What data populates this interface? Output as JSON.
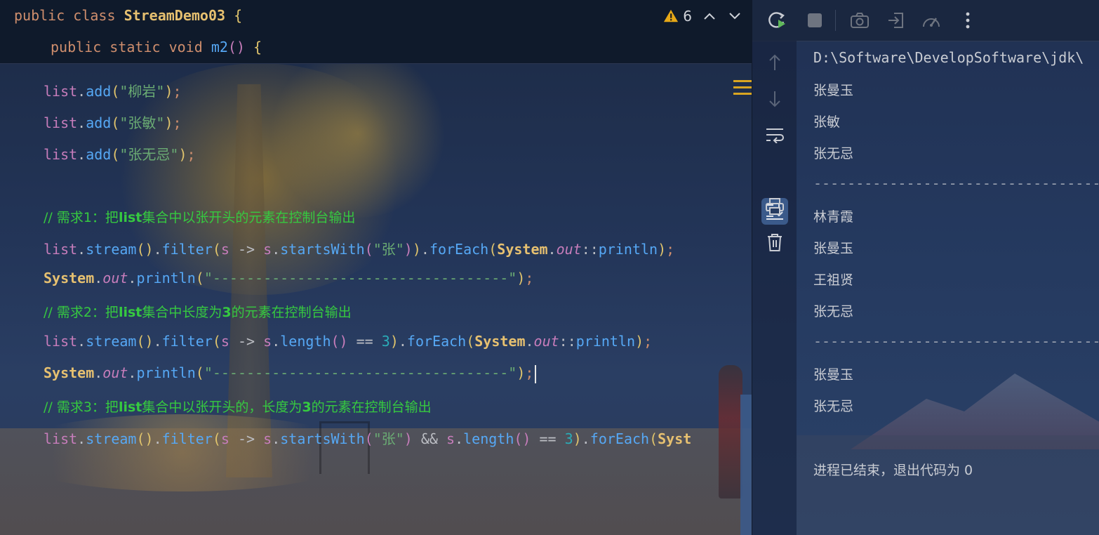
{
  "editor": {
    "sticky": {
      "line1": {
        "kw_public": "public",
        "kw_class": "class",
        "class_name": "StreamDemo03",
        "brace": "{"
      },
      "line2": {
        "kw_public": "public",
        "kw_static": "static",
        "kw_void": "void",
        "method": "m2",
        "parens": "()",
        "brace": "{"
      }
    },
    "warnings": {
      "count": "6"
    },
    "code": {
      "l1": {
        "var": "list",
        "method": "add",
        "arg": "\"柳岩\""
      },
      "l2": {
        "var": "list",
        "method": "add",
        "arg": "\"张敏\""
      },
      "l3": {
        "var": "list",
        "method": "add",
        "arg": "\"张无忌\""
      },
      "c1": {
        "prefix": "// 需求1：把",
        "bold": "list",
        "rest": "集合中以张开头的元素在控制台输出"
      },
      "s1": {
        "var": "list",
        "stream": "stream",
        "filter": "filter",
        "param": "s",
        "arrow": "->",
        "param2": "s",
        "startsWith": "startsWith",
        "arg": "\"张\"",
        "forEach": "forEach",
        "system": "System",
        "out": "out",
        "println": "println"
      },
      "p1": {
        "system": "System",
        "out": "out",
        "println": "println",
        "arg": "\"-----------------------------------\""
      },
      "c2": {
        "prefix": "// 需求2：把",
        "bold1": "list",
        "mid": "集合中长度为",
        "bold2": "3",
        "rest": "的元素在控制台输出"
      },
      "s2": {
        "var": "list",
        "stream": "stream",
        "filter": "filter",
        "param": "s",
        "arrow": "->",
        "param2": "s",
        "length": "length",
        "eq": "==",
        "num": "3",
        "forEach": "forEach",
        "system": "System",
        "out": "out",
        "println": "println"
      },
      "p2": {
        "system": "System",
        "out": "out",
        "println": "println",
        "arg": "\"-----------------------------------\""
      },
      "c3": {
        "prefix": "// 需求3：把",
        "bold1": "list",
        "mid": "集合中以张开头的，长度为",
        "bold2": "3",
        "rest": "的元素在控制台输出"
      },
      "s3": {
        "var": "list",
        "stream": "stream",
        "filter": "filter",
        "param": "s",
        "arrow": "->",
        "param2": "s",
        "startsWith": "startsWith",
        "arg": "\"张\"",
        "and": "&&",
        "param3": "s",
        "length": "length",
        "eq": "==",
        "num": "3",
        "forEach": "forEach",
        "system_partial": "Syst"
      }
    }
  },
  "run_panel": {
    "toolbar": {
      "icons": [
        "rerun-icon",
        "stop-icon",
        "camera-icon",
        "exit-icon",
        "profiler-icon",
        "more-icon"
      ]
    },
    "gutter": {
      "icons": [
        "up-arrow-icon",
        "down-arrow-icon",
        "soft-wrap-icon",
        "scroll-to-end-icon",
        "print-icon",
        "trash-icon"
      ]
    },
    "output": {
      "path": "D:\\Software\\DevelopSoftware\\jdk\\",
      "lines_group1": [
        "张曼玉",
        "张敏",
        "张无忌"
      ],
      "separator": "-----------------------------------",
      "lines_group2": [
        "林青霞",
        "张曼玉",
        "王祖贤",
        "张无忌"
      ],
      "lines_group3": [
        "张曼玉",
        "张无忌"
      ],
      "exit_message": "进程已结束，退出代码为 0"
    }
  },
  "colors": {
    "keyword": "#cf8e6d",
    "string": "#6aab73",
    "comment": "#36c940",
    "method": "#56a8f5",
    "field": "#c77dbb",
    "class": "#e6c070",
    "warning": "#e6a817"
  }
}
